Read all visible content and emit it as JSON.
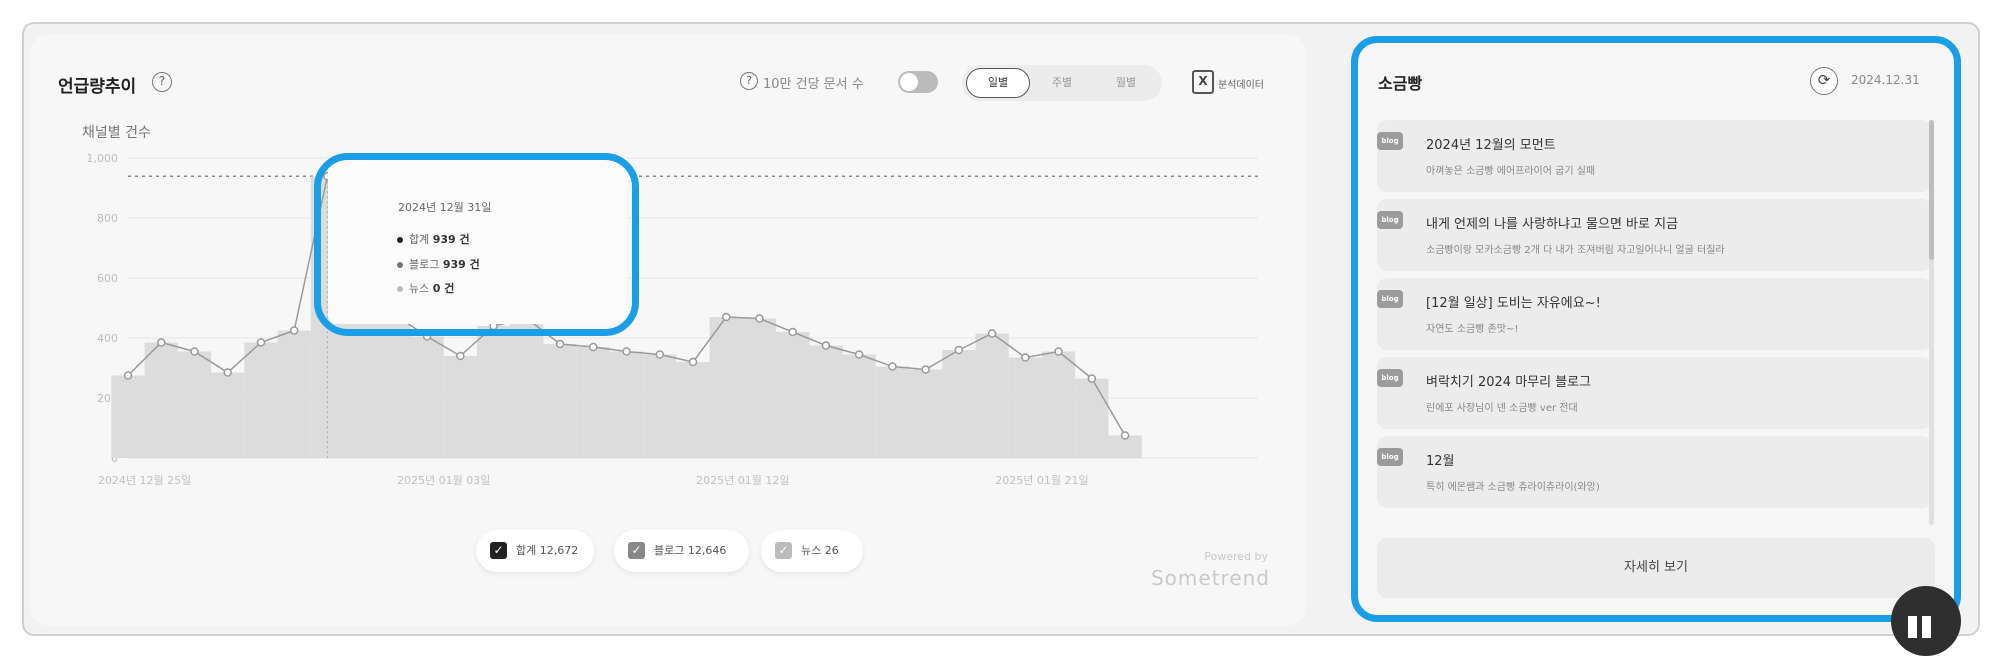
{
  "mentions": {
    "title": "언급량추이",
    "help_glyph": "?",
    "controls": {
      "per_doc_label": "10만 건당 문서 수",
      "per_doc_toggle_on": false,
      "periods": [
        "일별",
        "주별",
        "월별"
      ],
      "active_period": "일별",
      "excel_glyph": "X",
      "excel_label": "분석데이터"
    },
    "y_title": "채널별 건수",
    "tooltip": {
      "date": "2024년 12월 31일",
      "rows": [
        {
          "label": "합계",
          "value": "939 건",
          "color": "#222222"
        },
        {
          "label": "블로그",
          "value": "939 건",
          "color": "#777777"
        },
        {
          "label": "뉴스",
          "value": "0 건",
          "color": "#bbbbbb"
        }
      ]
    },
    "legend": [
      {
        "label": "합계 12,672",
        "checked": true,
        "color": "#222222"
      },
      {
        "label": "블로그 12,646",
        "checked": true,
        "color": "#888888"
      },
      {
        "label": "뉴스 26",
        "checked": true,
        "color": "#bbbbbb"
      }
    ],
    "powered_by": "Powered by",
    "brand": "Sometrend"
  },
  "chart_data": {
    "type": "line",
    "ylabel": "채널별 건수",
    "ylim": [
      0,
      1000
    ],
    "yticks": [
      "1,000",
      "800",
      "600",
      "400",
      "200",
      "0"
    ],
    "ytick_values": [
      1000,
      800,
      600,
      400,
      200,
      0
    ],
    "xtick_labels": [
      "2024년 12월 25일",
      "2025년 01월 03일",
      "2025년 01월 12일",
      "2025년 01월 21일"
    ],
    "xtick_indices": [
      0,
      9,
      18,
      27
    ],
    "x": [
      "2024-12-25",
      "2024-12-26",
      "2024-12-27",
      "2024-12-28",
      "2024-12-29",
      "2024-12-30",
      "2024-12-31",
      "2025-01-01",
      "2025-01-02",
      "2025-01-03",
      "2025-01-04",
      "2025-01-05",
      "2025-01-06",
      "2025-01-07",
      "2025-01-08",
      "2025-01-09",
      "2025-01-10",
      "2025-01-11",
      "2025-01-12",
      "2025-01-13",
      "2025-01-14",
      "2025-01-15",
      "2025-01-16",
      "2025-01-17",
      "2025-01-18",
      "2025-01-19",
      "2025-01-20",
      "2025-01-21",
      "2025-01-22",
      "2025-01-23",
      "2025-01-24",
      "2025-01-25",
      "2025-01-26",
      "2025-01-27",
      "2025-01-28"
    ],
    "series": [
      {
        "name": "합계",
        "values": [
          275,
          385,
          355,
          285,
          385,
          425,
          939,
          545,
          480,
          405,
          340,
          440,
          465,
          380,
          370,
          355,
          345,
          320,
          470,
          465,
          420,
          375,
          345,
          305,
          295,
          360,
          415,
          335,
          355,
          265,
          75
        ]
      },
      {
        "name": "블로그",
        "values": [
          275,
          385,
          355,
          285,
          385,
          425,
          939,
          545,
          480,
          405,
          340,
          440,
          465,
          380,
          370,
          355,
          345,
          320,
          470,
          465,
          420,
          375,
          345,
          305,
          295,
          360,
          415,
          335,
          355,
          265,
          75
        ]
      }
    ],
    "max_reference_value": 939,
    "grid": true,
    "legend_position": "bottom-center"
  },
  "sogeumppang": {
    "title": "소금빵",
    "refresh_glyph": "⟳",
    "date": "2024.12.31",
    "items": [
      {
        "icon": "blog",
        "title": "2024년 12월의 모먼트",
        "sub": "아껴놓은 소금빵 에어프라이어 굽기 실패"
      },
      {
        "icon": "blog",
        "title": "내게 언제의 나를 사랑하냐고 물으면 바로 지금",
        "sub": "소금빵이랑 모카소금빵 2개 다 내가 조져버림 자고일어나니 얼굴 터질라"
      },
      {
        "icon": "blog",
        "title": "[12월 일상] 도비는 자유에요~!",
        "sub": "자연도 소금빵 존맛~!"
      },
      {
        "icon": "blog",
        "title": "벼락치기 2024 마무리 블로그",
        "sub": "린에포 사장님이 넨 소금빵 ver 전대"
      },
      {
        "icon": "blog",
        "title": "12월",
        "sub": "특히 에몬쌤과 소금빵 츄라이츄라이(와앙)"
      }
    ],
    "more_label": "자세히 보기"
  }
}
